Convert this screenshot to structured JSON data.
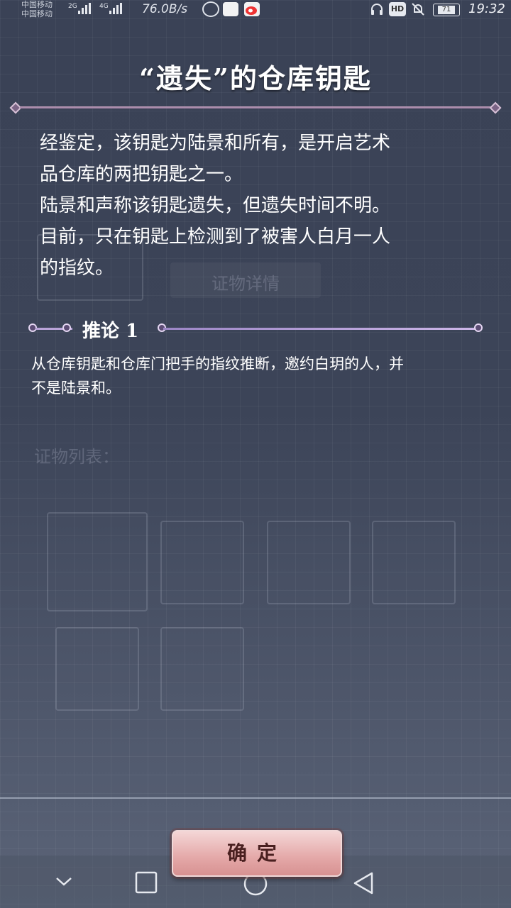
{
  "status_bar": {
    "carrier_top": "中国移动",
    "carrier_bottom": "中国移动",
    "network_1": "2G",
    "network_2": "4G",
    "speed": "76.0B/s",
    "battery": "71",
    "time": "19:32"
  },
  "dialog": {
    "title": "“遗失”的仓库钥匙",
    "description_lines": [
      "经鉴定，该钥匙为陆景和所有，是开启艺术",
      "品仓库的两把钥匙之一。",
      "陆景和声称该钥匙遗失，但遗失时间不明。",
      "目前，只在钥匙上检测到了被害人白月一人",
      "的指纹。"
    ],
    "inference_label": "推论 1",
    "inference_lines": [
      "从仓库钥匙和仓库门把手的指纹推断，邀约白玥的人，并",
      "不是陆景和。"
    ],
    "confirm_label": "确定"
  },
  "background": {
    "ghost_detail_button": "证物详情",
    "ghost_list_label": "证物列表："
  },
  "navigation": {
    "back_icon": "triangle-back-icon",
    "home_icon": "circle-home-icon",
    "recent_icon": "square-recent-icon",
    "hide_icon": "chevron-down-icon"
  }
}
